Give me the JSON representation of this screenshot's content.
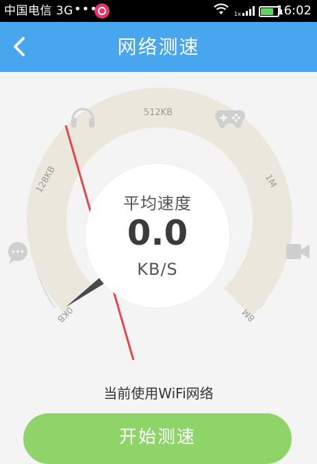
{
  "status_bar": {
    "carrier": "中国电信 3G",
    "dots": "•••",
    "signal_label": "1x",
    "time": "16:02"
  },
  "header": {
    "title": "网络测速"
  },
  "gauge": {
    "ticks": [
      "0KB",
      "128KB",
      "512KB",
      "1M",
      "8M"
    ],
    "average_label": "平均速度",
    "speed_value": "0.0",
    "unit": "KB/S",
    "icons": [
      "headphones-icon",
      "gamepad-icon",
      "chat-icon",
      "video-camera-icon"
    ],
    "progress_fraction": 0
  },
  "network_note": "当前使用WiFi网络",
  "start_button_label": "开始测速",
  "colors": {
    "header": "#48a6ee",
    "button": "#8ed468",
    "gauge_fill": "#ece7dc",
    "annotation_arrow": "#e8424a"
  }
}
